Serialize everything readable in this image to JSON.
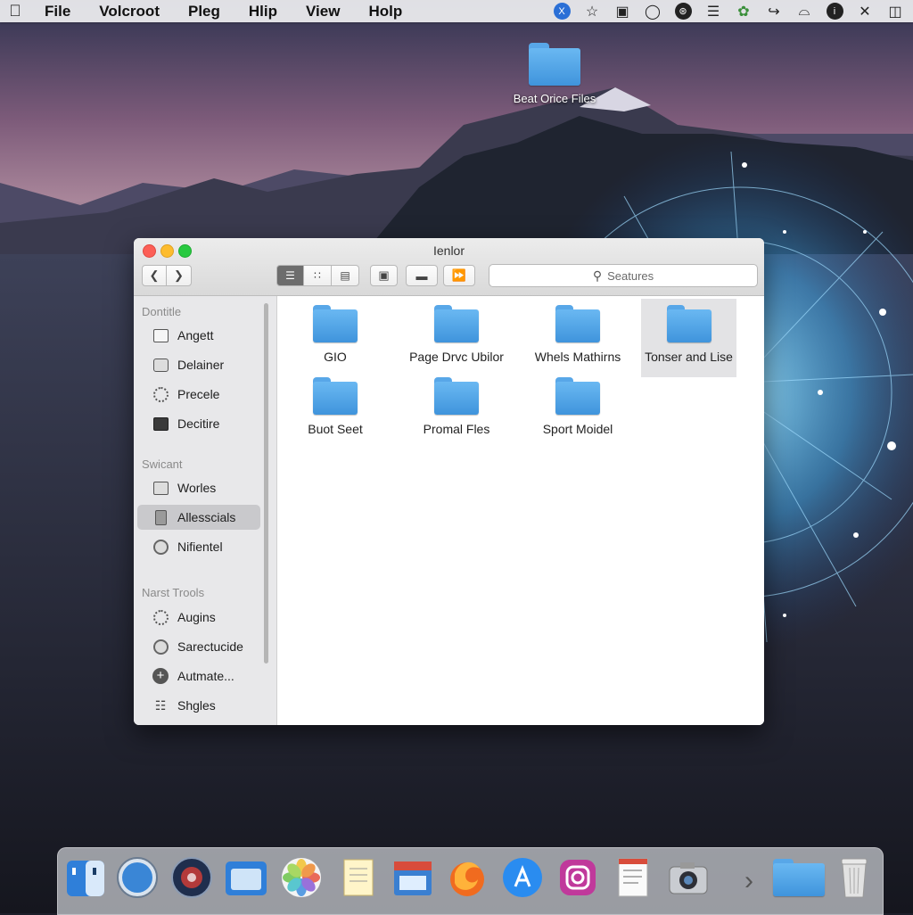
{
  "menubar": {
    "items": [
      "File",
      "Volcroot",
      "Pleg",
      "Hlip",
      "View",
      "Holp"
    ],
    "status_icons": [
      "x-icon",
      "star-icon",
      "film-icon",
      "clock-icon",
      "bluetooth-icon",
      "menu-icon",
      "palette-icon",
      "chevron-icon",
      "wifi-icon",
      "info-icon",
      "close-icon",
      "trash-icon"
    ]
  },
  "desktop": {
    "icon_label": "Beat Orice Files"
  },
  "window": {
    "title": "Ienlor",
    "search_placeholder": "Seatures",
    "sidebar": {
      "sections": [
        {
          "heading": "Dontitle",
          "items": [
            {
              "label": "Angett",
              "icon": "document-icon"
            },
            {
              "label": "Delainer",
              "icon": "folder-icon"
            },
            {
              "label": "Precele",
              "icon": "gear-icon"
            },
            {
              "label": "Decitire",
              "icon": "terminal-icon"
            }
          ]
        },
        {
          "heading": "Swicant",
          "items": [
            {
              "label": "Worles",
              "icon": "folder-icon"
            },
            {
              "label": "Allesscials",
              "icon": "sheet-icon",
              "selected": true
            },
            {
              "label": "Nifientel",
              "icon": "info-icon"
            }
          ]
        },
        {
          "heading": "Narst Trools",
          "items": [
            {
              "label": "Augins",
              "icon": "gear-icon"
            },
            {
              "label": "Sarectucide",
              "icon": "disc-icon"
            },
            {
              "label": "Autmate...",
              "icon": "plus-icon"
            },
            {
              "label": "Shgles",
              "icon": "tree-icon"
            }
          ]
        }
      ]
    },
    "folders": [
      {
        "label": "GIO"
      },
      {
        "label": "Page Drvc Ubilor"
      },
      {
        "label": "Whels Mathirns"
      },
      {
        "label": "Tonser and Lise",
        "selected": true
      },
      {
        "label": "Buot Seet"
      },
      {
        "label": "Promal Fles"
      },
      {
        "label": "Sport Moidel"
      }
    ]
  },
  "dock": {
    "apps": [
      "finder-icon",
      "safari-icon",
      "compass-icon",
      "notes-app-icon",
      "photos-icon",
      "stickies-icon",
      "preview-icon",
      "firefox-icon",
      "app-store-icon",
      "instagram-icon",
      "textedit-icon",
      "camera-icon",
      "downloads-folder-icon",
      "trash-icon"
    ]
  }
}
